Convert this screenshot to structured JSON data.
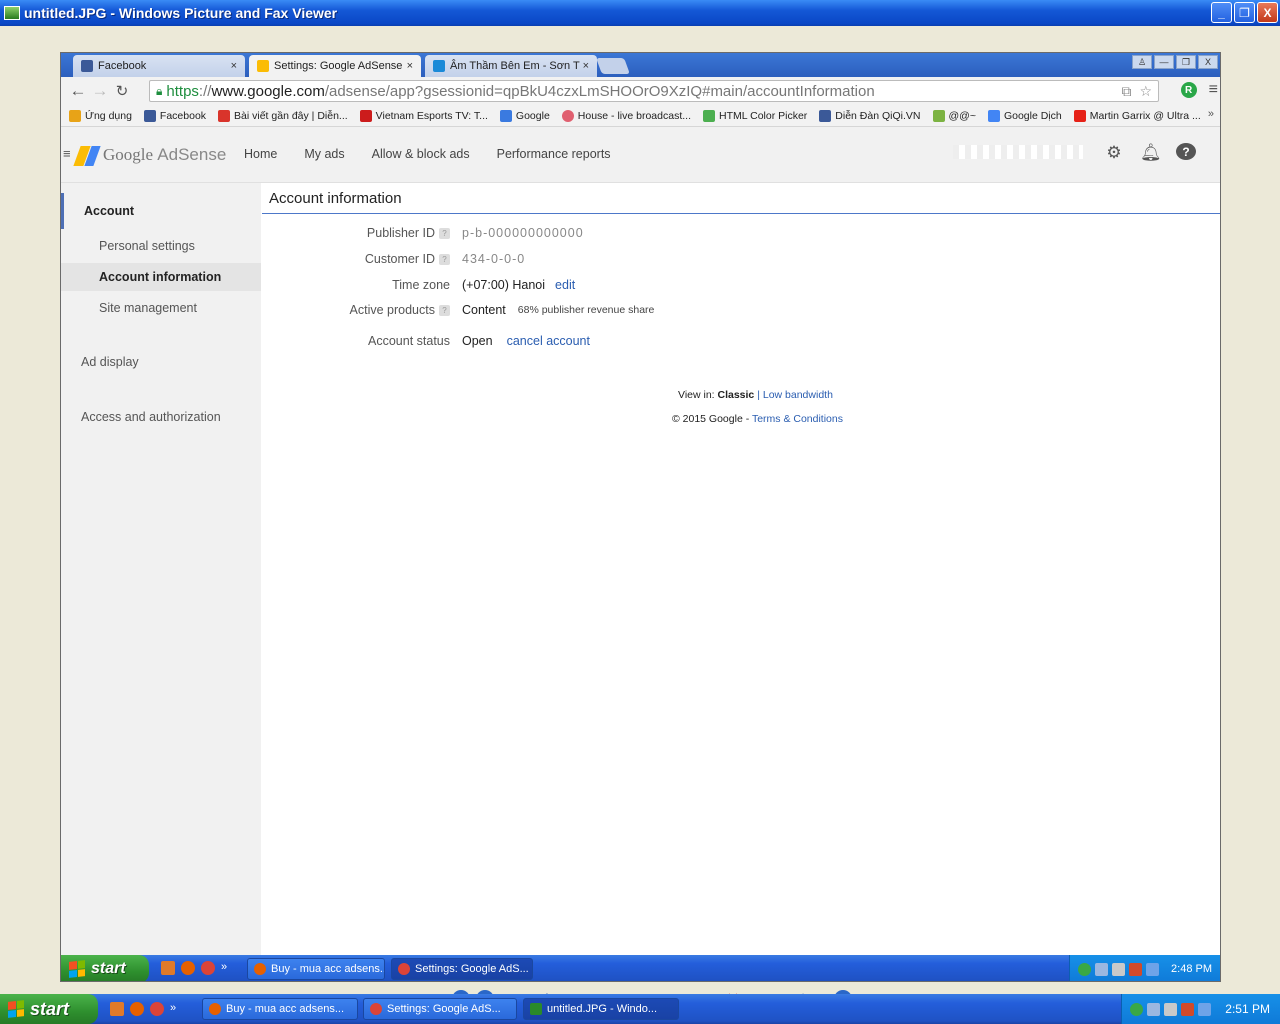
{
  "viewer": {
    "title": "untitled.JPG - Windows Picture and Fax Viewer",
    "controls": [
      "_",
      "❐",
      "X"
    ]
  },
  "browser": {
    "tabs": [
      {
        "label": "Facebook",
        "close": "×",
        "color": "#3b5998"
      },
      {
        "label": "Settings: Google AdSense",
        "close": "×",
        "color": "#fbbc05"
      },
      {
        "label": "Âm Thầm Bên Em - Sơn T",
        "close": "×",
        "color": "#1a8ad8"
      }
    ],
    "window_controls": [
      "♙",
      "—",
      "❐",
      "X"
    ],
    "url": {
      "scheme": "https",
      "sep": "://",
      "host": "www.google.com",
      "path": "/adsense/app?gsessionid=qpBkU4czxLmSHOOrO9XzIQ#main/accountInformation"
    },
    "extension_label": "R",
    "bookmarks": [
      {
        "label": "Ứng dụng",
        "color": "#e8a317"
      },
      {
        "label": "Facebook",
        "color": "#3b5998"
      },
      {
        "label": "Bài viết gần đây | Diễn...",
        "color": "#d9342b"
      },
      {
        "label": "Vietnam Esports TV: T...",
        "color": "#cc1c1c"
      },
      {
        "label": "Google",
        "color": "#3a7ae0"
      },
      {
        "label": "House - live broadcast...",
        "color": "#e06070"
      },
      {
        "label": "HTML Color Picker",
        "color": "#4caf50"
      },
      {
        "label": "Diễn Đàn QiQi.VN",
        "color": "#3b5998"
      },
      {
        "label": "@@~",
        "color": "#7cb342"
      },
      {
        "label": "Google Dịch",
        "color": "#4285f4"
      },
      {
        "label": "Martin Garrix @ Ultra ...",
        "color": "#e62117"
      }
    ],
    "bookmarks_more": "»"
  },
  "adsense": {
    "logo_google": "Google",
    "logo_product": "AdSense",
    "nav": [
      "Home",
      "My ads",
      "Allow & block ads",
      "Performance reports"
    ],
    "sidebar": {
      "account": "Account",
      "personal_settings": "Personal settings",
      "account_information": "Account information",
      "site_management": "Site management",
      "ad_display": "Ad display",
      "access": "Access and authorization"
    },
    "page_title": "Account information",
    "fields": {
      "publisher_id_label": "Publisher ID",
      "publisher_id_value": "p-b-000000000000",
      "customer_id_label": "Customer ID",
      "customer_id_value": "434-0-0-0",
      "time_zone_label": "Time zone",
      "time_zone_value": "(+07:00) Hanoi",
      "time_zone_edit": "edit",
      "active_products_label": "Active products",
      "active_products_value": "Content",
      "active_products_share": "68% publisher revenue share",
      "account_status_label": "Account status",
      "account_status_value": "Open",
      "cancel_link": "cancel account"
    },
    "help_mark": "?",
    "footer": {
      "view_in": "View in:",
      "classic": "Classic",
      "sep": "|",
      "low_bandwidth": "Low bandwidth",
      "copyright": "© 2015 Google -",
      "terms": "Terms & Conditions"
    }
  },
  "inner_taskbar": {
    "start": "start",
    "more": "»",
    "items": [
      {
        "label": "Buy - mua acc adsens...",
        "color": "#e66000"
      },
      {
        "label": "Settings: Google AdS...",
        "color": "#db4437"
      }
    ],
    "clock": "2:48 PM"
  },
  "outer_taskbar": {
    "start": "start",
    "more": "»",
    "items": [
      {
        "label": "Buy - mua acc adsens...",
        "color": "#e66000"
      },
      {
        "label": "Settings: Google AdS...",
        "color": "#db4437"
      },
      {
        "label": "untitled.JPG - Windo...",
        "color": "#2a8a2a"
      }
    ],
    "clock": "2:51 PM"
  }
}
